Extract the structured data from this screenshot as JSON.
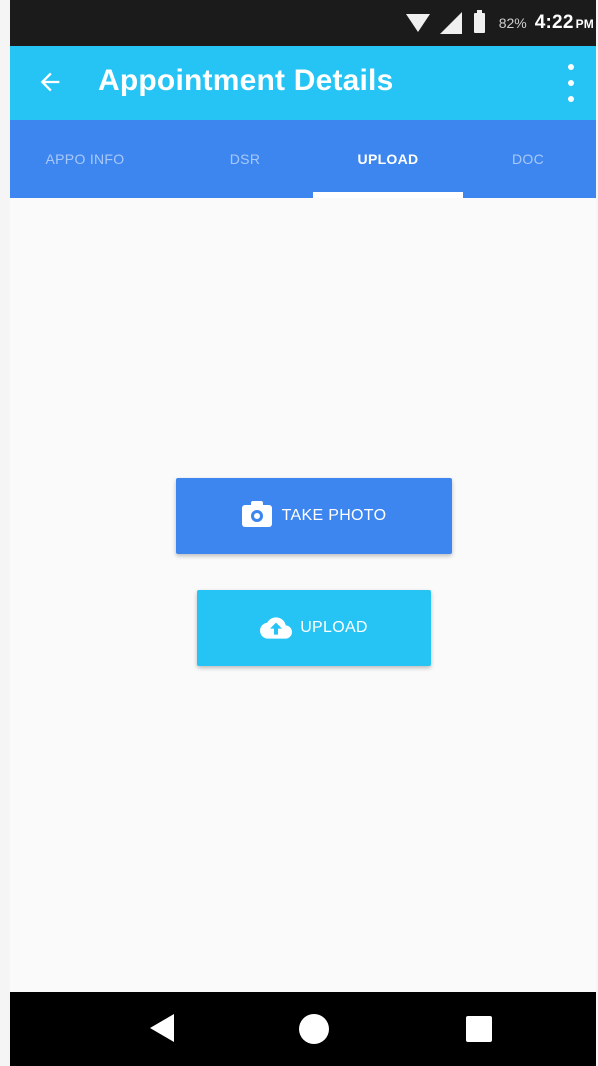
{
  "status_bar": {
    "battery": "82%",
    "time": "4:22",
    "ampm": "PM"
  },
  "app_bar": {
    "title": "Appointment Details"
  },
  "tabs": [
    {
      "label": "APPO INFO"
    },
    {
      "label": "DSR"
    },
    {
      "label": "UPLOAD"
    },
    {
      "label": "DOC"
    }
  ],
  "active_tab_index": 2,
  "actions": {
    "take_photo_label": "TAKE PHOTO",
    "upload_label": "UPLOAD"
  },
  "colors": {
    "app_bar": "#25c4f4",
    "tab_bar": "#3d86f0",
    "take_photo_button": "#3d86f0",
    "upload_button": "#25c4f4"
  },
  "icons": {
    "back": "arrow-left-icon",
    "overflow": "more-vert-icon",
    "take_photo": "camera-icon",
    "upload": "cloud-upload-icon",
    "nav_back": "nav-back-icon",
    "nav_home": "nav-home-icon",
    "nav_recents": "nav-recents-icon"
  }
}
